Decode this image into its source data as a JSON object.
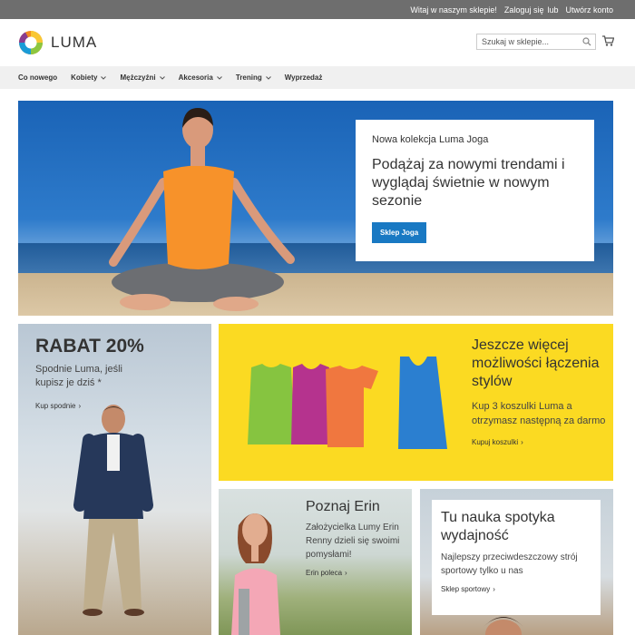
{
  "topbar": {
    "welcome": "Witaj w naszym sklepie!",
    "login": "Zaloguj się",
    "or": "lub",
    "register": "Utwórz konto"
  },
  "header": {
    "logo_text": "LUMA",
    "search_placeholder": "Szukaj w sklepie...",
    "colors": {
      "topbar": "#6e6e6e",
      "nav": "#f0f0f0",
      "accent": "#1979c3"
    }
  },
  "nav": {
    "items": [
      {
        "label": "Co nowego",
        "has_dropdown": false
      },
      {
        "label": "Kobiety",
        "has_dropdown": true
      },
      {
        "label": "Mężczyźni",
        "has_dropdown": true
      },
      {
        "label": "Akcesoria",
        "has_dropdown": true
      },
      {
        "label": "Trening",
        "has_dropdown": true
      },
      {
        "label": "Wyprzedaż",
        "has_dropdown": false
      }
    ]
  },
  "hero": {
    "kicker": "Nowa kolekcja Luma Joga",
    "title": "Podążaj za nowymi trendami i wyglądaj świetnie w nowym sezonie",
    "button": "Sklep Joga"
  },
  "promo_pants": {
    "title": "RABAT 20%",
    "desc": "Spodnie Luma, jeśli kupisz je dziś *",
    "link": "Kup spodnie"
  },
  "promo_tees": {
    "title": "Jeszcze więcej możliwości łączenia stylów",
    "desc": "Kup 3 koszulki Luma a otrzymasz następną za darmo",
    "link": "Kupuj koszulki",
    "colors": [
      "#86c440",
      "#b5338e",
      "#f0773f",
      "#2b7fd0"
    ]
  },
  "promo_erin": {
    "title": "Poznaj Erin",
    "desc": "Założycielka Lumy Erin Renny dzieli się swoimi pomysłami!",
    "link": "Erin poleca"
  },
  "promo_perf": {
    "title": "Tu nauka spotyka wydajność",
    "desc": "Najlepszy przeciwdeszczowy strój sportowy tylko u nas",
    "link": "Sklep sportowy"
  }
}
